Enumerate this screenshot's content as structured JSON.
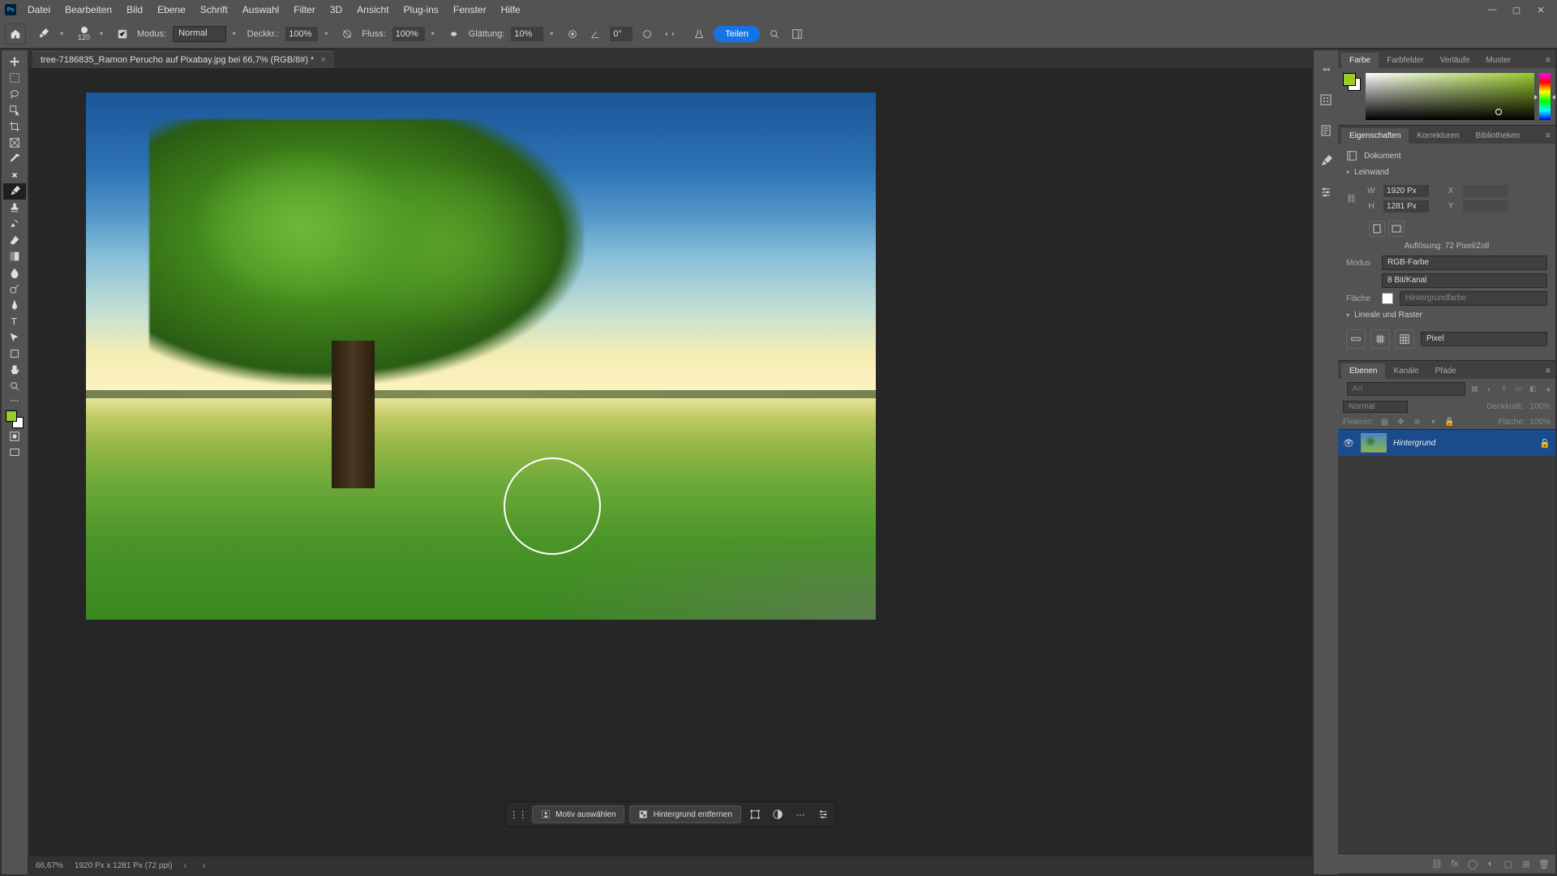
{
  "app_logo": "Ps",
  "menu": [
    "Datei",
    "Bearbeiten",
    "Bild",
    "Ebene",
    "Schrift",
    "Auswahl",
    "Filter",
    "3D",
    "Ansicht",
    "Plug-ins",
    "Fenster",
    "Hilfe"
  ],
  "options": {
    "brush_size": "120",
    "mode_label": "Modus:",
    "mode_value": "Normal",
    "opacity_label": "Deckkr.:",
    "opacity_value": "100%",
    "flow_label": "Fluss:",
    "flow_value": "100%",
    "smoothing_label": "Glättung:",
    "smoothing_value": "10%",
    "angle_value": "0°",
    "share_label": "Teilen"
  },
  "doc": {
    "tab_title": "tree-7186835_Ramon Perucho auf Pixabay.jpg bei 66,7% (RGB/8#) *"
  },
  "quickbar": {
    "select_subject": "Motiv auswählen",
    "remove_bg": "Hintergrund entfernen"
  },
  "status": {
    "zoom": "66,67%",
    "doc_info": "1920 Px x 1281 Px (72 ppi)"
  },
  "panels": {
    "color": {
      "tabs": [
        "Farbe",
        "Farbfelder",
        "Verläufe",
        "Muster"
      ],
      "fg_color": "#9acc2c"
    },
    "props": {
      "tabs": [
        "Eigenschaften",
        "Korrekturen",
        "Bibliotheken"
      ],
      "doc_label": "Dokument",
      "canvas_section": "Leinwand",
      "w_label": "W",
      "w_value": "1920 Px",
      "x_label": "X",
      "h_label": "H",
      "h_value": "1281 Px",
      "y_label": "Y",
      "resolution": "Auflösung: 72 Pixel/Zoll",
      "mode_label": "Modus",
      "mode_value": "RGB-Farbe",
      "depth_value": "8 Bit/Kanal",
      "fill_label": "Fläche",
      "fill_value": "Hintergrundfarbe",
      "rulers_section": "Lineale und Raster",
      "rulers_unit": "Pixel"
    },
    "layers": {
      "tabs": [
        "Ebenen",
        "Kanäle",
        "Pfade"
      ],
      "search_placeholder": "Art",
      "blend_label": "Normal",
      "opacity_label": "Deckkraft:",
      "opacity_value": "100%",
      "lock_label": "Fixieren:",
      "fill_label": "Fläche:",
      "fill_value": "100%",
      "layer_name": "Hintergrund"
    }
  }
}
